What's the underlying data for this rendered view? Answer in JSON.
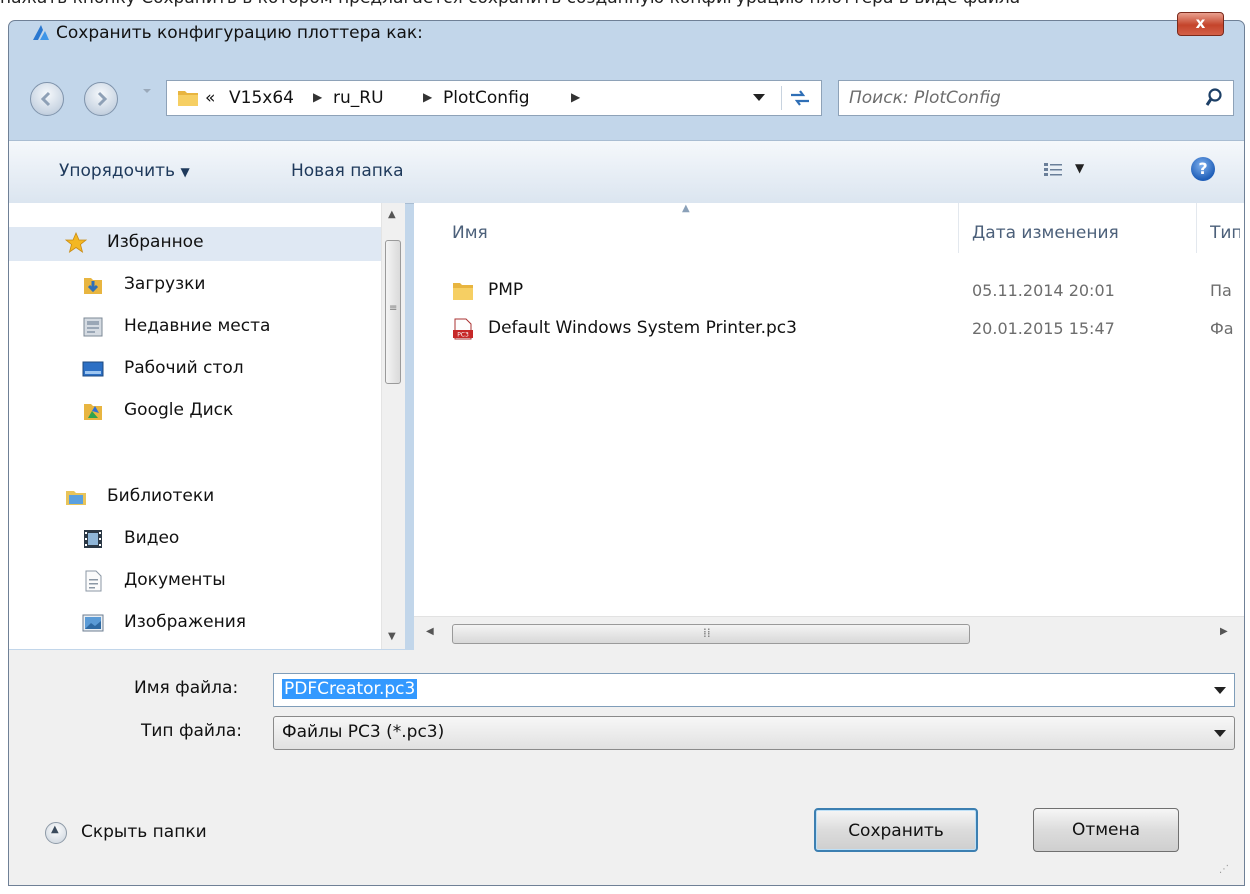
{
  "background_caption": "нажать кнопку Сохранить в котором предлагается сохранить созданную конфигурацию плоттера в виде файла",
  "window": {
    "title": "Сохранить конфигурацию плоттера как:"
  },
  "navigation": {
    "breadcrumb": {
      "overflow": "«",
      "segments": [
        "V15x64",
        "ru_RU",
        "PlotConfig"
      ]
    },
    "search_placeholder": "Поиск: PlotConfig"
  },
  "commandbar": {
    "organize_label": "Упорядочить",
    "new_folder_label": "Новая папка",
    "help_glyph": "?"
  },
  "sidebar": {
    "favorites": {
      "label": "Избранное",
      "items": [
        {
          "label": "Загрузки",
          "icon": "downloads-icon"
        },
        {
          "label": "Недавние места",
          "icon": "recent-places-icon"
        },
        {
          "label": "Рабочий стол",
          "icon": "desktop-icon"
        },
        {
          "label": "Google Диск",
          "icon": "google-drive-icon"
        }
      ]
    },
    "libraries": {
      "label": "Библиотеки",
      "items": [
        {
          "label": "Видео",
          "icon": "video-icon"
        },
        {
          "label": "Документы",
          "icon": "documents-icon"
        },
        {
          "label": "Изображения",
          "icon": "images-icon"
        }
      ]
    }
  },
  "file_list": {
    "columns": [
      "Имя",
      "Дата изменения",
      "Тип"
    ],
    "rows": [
      {
        "name": "PMP",
        "modified": "05.11.2014 20:01",
        "type": "Па",
        "icon": "folder-icon"
      },
      {
        "name": "Default Windows System Printer.pc3",
        "modified": "20.01.2015 15:47",
        "type": "Фа",
        "icon": "pc3-file-icon"
      }
    ]
  },
  "form": {
    "filename_label": "Имя файла:",
    "filename_value": "PDFCreator.pc3",
    "filetype_label": "Тип файла:",
    "filetype_value": "Файлы PC3 (*.pc3)"
  },
  "buttons": {
    "hide_folders": "Скрыть папки",
    "save": "Сохранить",
    "cancel": "Отмена",
    "close": "x"
  },
  "colors": {
    "window_frame": "#c2d6ea",
    "selection": "#3399ff",
    "folder": "#e8b540"
  }
}
